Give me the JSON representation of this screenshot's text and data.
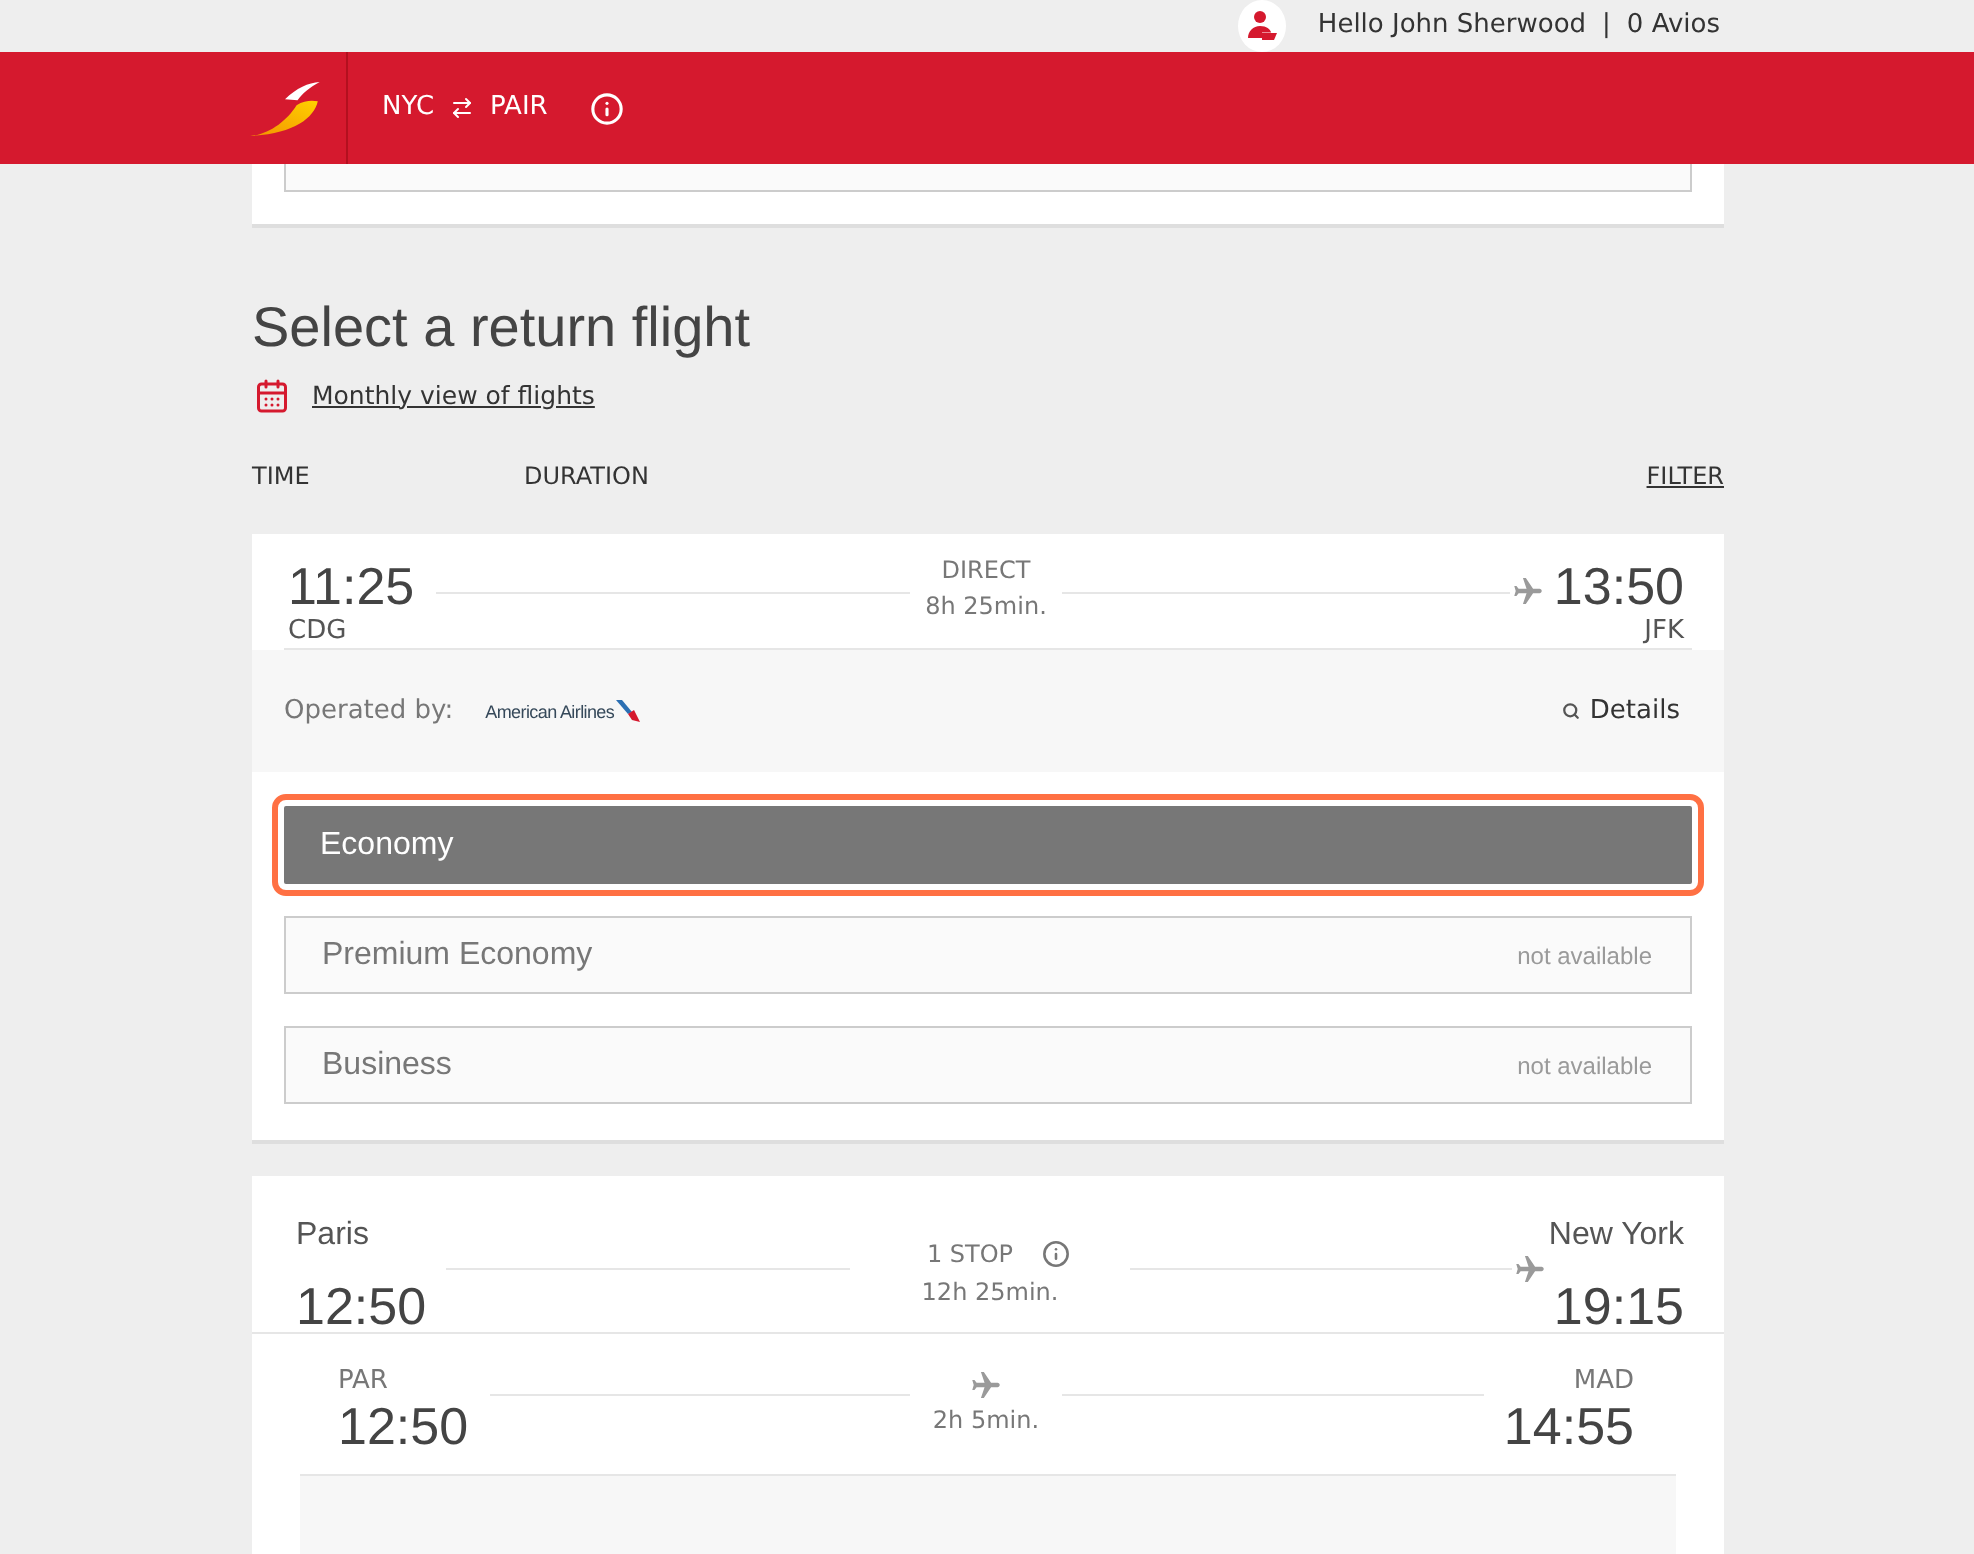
{
  "top_bar": {
    "greeting": "Hello John Sherwood",
    "separator": "|",
    "balance": "0 Avios"
  },
  "header": {
    "origin": "NYC",
    "destination": "PAIR"
  },
  "title": "Select a return flight",
  "calendar_link": "Monthly view of flights",
  "columns": {
    "time": "TIME",
    "duration": "DURATION",
    "filter": "FILTER"
  },
  "flights": [
    {
      "kind": "direct",
      "departure": {
        "time": "11:25",
        "airport": "CDG"
      },
      "stops": "DIRECT",
      "duration": "8h 25min.",
      "arrival": {
        "time": "13:50",
        "airport": "JFK"
      },
      "operator": {
        "label": "Operated by:",
        "airline": "American Airlines"
      },
      "details": "Details",
      "fares": [
        {
          "name": "Economy",
          "selected": true,
          "disabled": false
        },
        {
          "name": "Premium Economy",
          "selected": false,
          "disabled": true,
          "note": "not available"
        },
        {
          "name": "Business",
          "selected": false,
          "disabled": true,
          "note": "not available"
        }
      ]
    },
    {
      "kind": "connecting",
      "departure": {
        "city": "Paris",
        "time": "12:50"
      },
      "stops": "1 STOP",
      "duration": "12h 25min.",
      "arrival": {
        "city": "New York",
        "time": "19:15"
      },
      "segments": [
        {
          "departure": {
            "airport": "PAR",
            "time": "12:50"
          },
          "duration": "2h 5min.",
          "arrival": {
            "airport": "MAD",
            "time": "14:55"
          }
        }
      ]
    }
  ]
}
